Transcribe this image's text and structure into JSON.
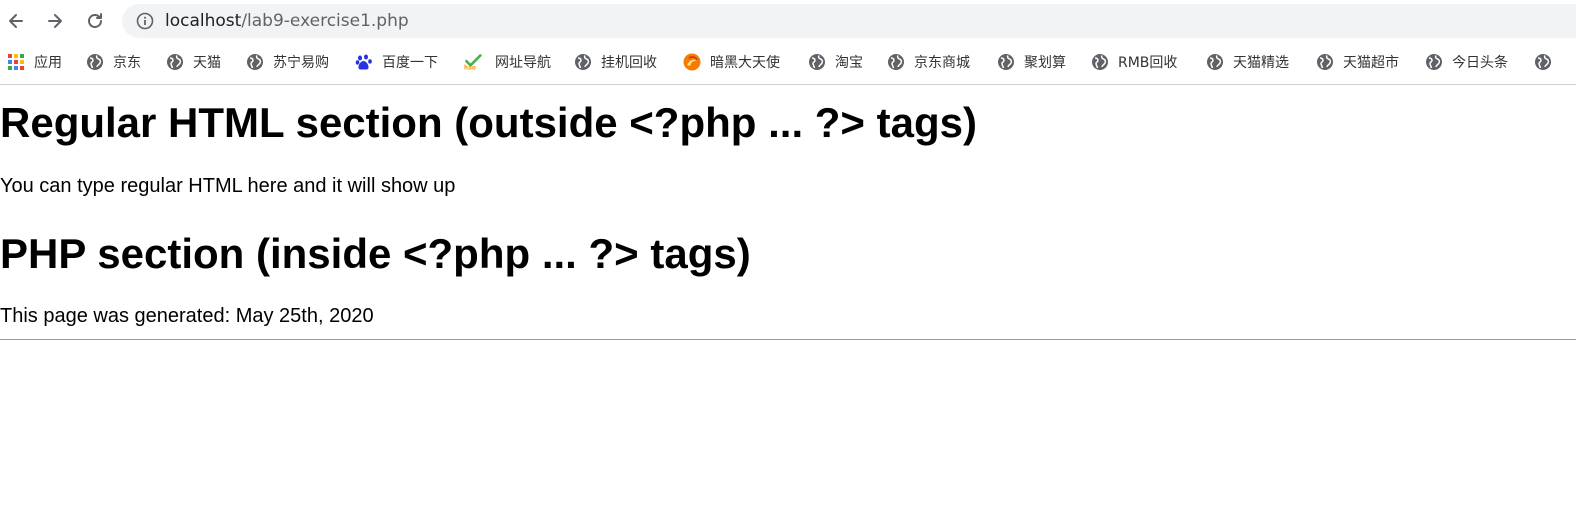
{
  "browser": {
    "url_host": "localhost",
    "url_path": "/lab9-exercise1.php",
    "bookmarks": [
      {
        "label": "应用",
        "icon": "apps-grid-icon"
      },
      {
        "label": "京东",
        "icon": "globe-icon"
      },
      {
        "label": "天猫",
        "icon": "globe-icon"
      },
      {
        "label": "苏宁易购",
        "icon": "globe-icon"
      },
      {
        "label": "百度一下",
        "icon": "baidu-paw-icon"
      },
      {
        "label": "网址导航",
        "icon": "hao-check-icon"
      },
      {
        "label": "挂机回收",
        "icon": "globe-icon"
      },
      {
        "label": "暗黑大天使",
        "icon": "orange-swirl-icon"
      },
      {
        "label": "淘宝",
        "icon": "globe-icon"
      },
      {
        "label": "京东商城",
        "icon": "globe-icon"
      },
      {
        "label": "聚划算",
        "icon": "globe-icon"
      },
      {
        "label": "RMB回收",
        "icon": "globe-icon"
      },
      {
        "label": "天猫精选",
        "icon": "globe-icon"
      },
      {
        "label": "天猫超市",
        "icon": "globe-icon"
      },
      {
        "label": "今日头条",
        "icon": "globe-icon"
      }
    ]
  },
  "page": {
    "heading1": "Regular HTML section (outside <?php ... ?> tags)",
    "para1": "You can type regular HTML here and it will show up",
    "heading2": "PHP section (inside <?php ... ?> tags)",
    "para2": "This page was generated: May 25th, 2020"
  },
  "colors": {
    "omnibox_bg": "#f1f3f4",
    "globe_icon": "#5f6368",
    "rule": "#9a9a9a"
  }
}
